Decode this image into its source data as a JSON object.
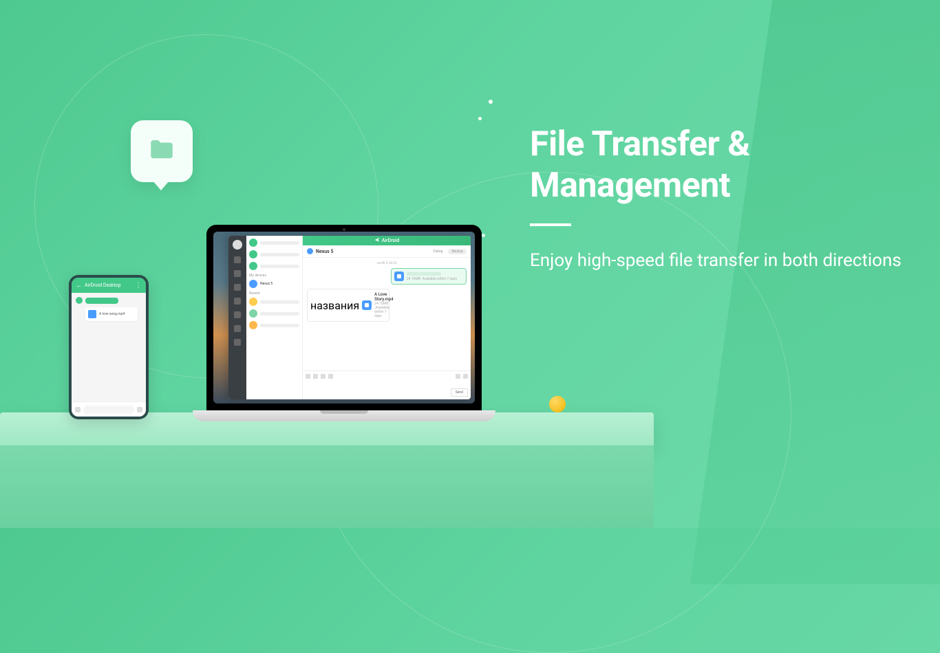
{
  "hero": {
    "title": "File Transfer & Management",
    "subtitle": "Enjoy high-speed file transfer in both directions"
  },
  "app": {
    "brand": "AirDroid",
    "chat_device": "Nexus 5",
    "tabs": {
      "dialog": "Dialog",
      "backup": "Backup"
    },
    "timestamp": "via Wi-Fi 03:22",
    "file_out": {
      "size": "24.16MB",
      "hint": "Available within 7 days"
    },
    "file_in": {
      "name": "A Love Story.mp4",
      "size": "24.16MB",
      "hint": "Available within 7 days"
    },
    "sections": {
      "devices": "My devices",
      "nexus": "Nexus 5",
      "recent": "Recent"
    },
    "send": "Send"
  },
  "phone": {
    "title": "AirDroid Desktop",
    "file": "A love song.mp4"
  }
}
